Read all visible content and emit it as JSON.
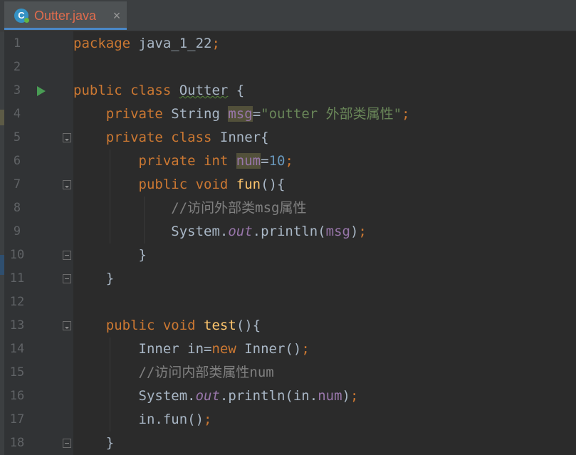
{
  "tab": {
    "title": "Outter.java",
    "close": "×",
    "icon": "C"
  },
  "lines": [
    {
      "n": "1",
      "parts": [
        [
          "kw",
          "package "
        ],
        [
          "",
          "java_1_22"
        ],
        [
          "kw",
          ";"
        ]
      ]
    },
    {
      "n": "2",
      "parts": []
    },
    {
      "n": "3",
      "parts": [
        [
          "kw",
          "public class "
        ],
        [
          "squiggle",
          "Outter"
        ],
        [
          "",
          " {"
        ]
      ]
    },
    {
      "n": "4",
      "parts": [
        [
          "",
          "    "
        ],
        [
          "kw",
          "private "
        ],
        [
          "",
          "String "
        ],
        [
          "field hl",
          "msg"
        ],
        [
          "",
          "="
        ],
        [
          "str",
          "\"outter 外部类属性\""
        ],
        [
          "kw",
          ";"
        ]
      ]
    },
    {
      "n": "5",
      "parts": [
        [
          "",
          "    "
        ],
        [
          "kw",
          "private class "
        ],
        [
          "",
          "Inner{"
        ]
      ]
    },
    {
      "n": "6",
      "parts": [
        [
          "",
          "        "
        ],
        [
          "kw",
          "private int "
        ],
        [
          "field hl",
          "num"
        ],
        [
          "",
          "="
        ],
        [
          "num",
          "10"
        ],
        [
          "kw",
          ";"
        ]
      ]
    },
    {
      "n": "7",
      "parts": [
        [
          "",
          "        "
        ],
        [
          "kw",
          "public void "
        ],
        [
          "fn",
          "fun"
        ],
        [
          "",
          "(){"
        ]
      ]
    },
    {
      "n": "8",
      "parts": [
        [
          "",
          "            "
        ],
        [
          "cmt",
          "//访问外部类msg属性"
        ]
      ]
    },
    {
      "n": "9",
      "parts": [
        [
          "",
          "            System."
        ],
        [
          "static",
          "out"
        ],
        [
          "",
          ".println("
        ],
        [
          "field",
          "msg"
        ],
        [
          "",
          ")"
        ],
        [
          "kw",
          ";"
        ]
      ]
    },
    {
      "n": "10",
      "parts": [
        [
          "",
          "        }"
        ]
      ]
    },
    {
      "n": "11",
      "parts": [
        [
          "",
          "    }"
        ]
      ]
    },
    {
      "n": "12",
      "parts": []
    },
    {
      "n": "13",
      "parts": [
        [
          "",
          "    "
        ],
        [
          "kw",
          "public void "
        ],
        [
          "fn",
          "test"
        ],
        [
          "",
          "(){"
        ]
      ]
    },
    {
      "n": "14",
      "parts": [
        [
          "",
          "        Inner in="
        ],
        [
          "kw",
          "new "
        ],
        [
          "",
          "Inner()"
        ],
        [
          "kw",
          ";"
        ]
      ]
    },
    {
      "n": "15",
      "parts": [
        [
          "",
          "        "
        ],
        [
          "cmt",
          "//访问内部类属性num"
        ]
      ]
    },
    {
      "n": "16",
      "parts": [
        [
          "",
          "        System."
        ],
        [
          "static",
          "out"
        ],
        [
          "",
          ".println(in."
        ],
        [
          "field",
          "num"
        ],
        [
          "",
          ")"
        ],
        [
          "kw",
          ";"
        ]
      ]
    },
    {
      "n": "17",
      "parts": [
        [
          "",
          "        in.fun()"
        ],
        [
          "kw",
          ";"
        ]
      ]
    },
    {
      "n": "18",
      "parts": [
        [
          "",
          "    }"
        ]
      ]
    }
  ],
  "gutter_markers": {
    "run_line": "3",
    "fold_open": [
      "5",
      "7",
      "13"
    ],
    "fold_close": [
      "10",
      "11",
      "18"
    ]
  }
}
